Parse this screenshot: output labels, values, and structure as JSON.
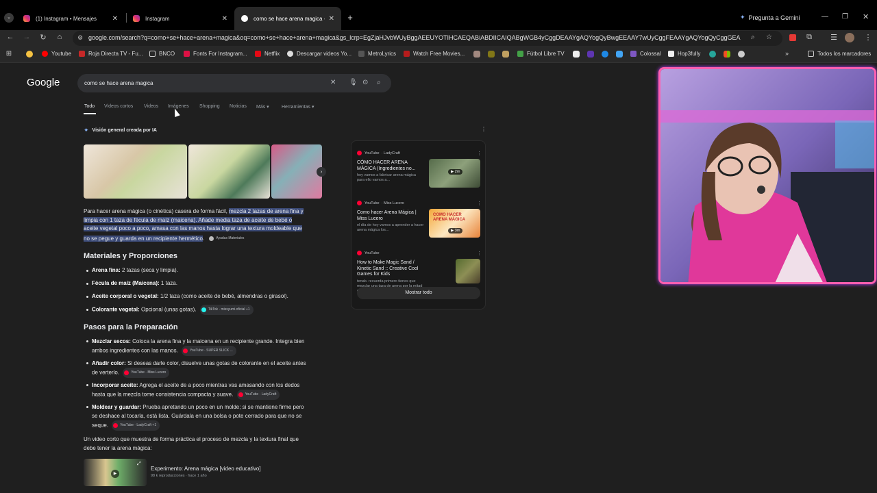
{
  "tabs": [
    {
      "title": "(1) Instagram • Mensajes",
      "active": false
    },
    {
      "title": "Instagram",
      "active": false
    },
    {
      "title": "como se hace arena magica - B",
      "active": true
    }
  ],
  "gemini_label": "Pregunta a Gemini",
  "url": "google.com/search?q=como+se+hace+arena+magica&oq=como+se+hace+arena+magica&gs_lcrp=EgZjaHJvbWUyBggAEEUYOTIHCAEQABiABDIICAIQABgWGB4yCggDEAAYgAQYogQyBwgEEAAY7wUyCggFEAAYgAQYogQyCggGEA",
  "bookmarks": [
    "Youtube",
    "Roja Directa TV - Fu...",
    "BNCO",
    "Fonts For Instagram...",
    "Netflix",
    "Descargar videos Yo...",
    "MetroLyrics",
    "Watch Free Movies...",
    "Fútbol Libre TV",
    "Colossal",
    "Hop3fully"
  ],
  "all_bookmarks": "Todos los marcadores",
  "google_logo": "Google",
  "search_query": "como se hace arena magica",
  "nav_tabs": [
    "Todo",
    "Videos cortos",
    "Videos",
    "Imágenes",
    "Shopping",
    "Noticias",
    "Más",
    "Herramientas"
  ],
  "ai_overview_label": "Visión general creada por IA",
  "intro": {
    "plain": "Para hacer arena mágica (o cinética) casera de forma fácil, ",
    "line1_hl": "mezcla 2 tazas de arena fina y",
    "line2_hl": "limpia con 1 taza de fécula de maíz (maicena). Añade media taza de aceite de bebé o",
    "line3_hl": "aceite vegetal poco a poco, amasa con las manos hasta lograr una textura moldeable que",
    "line4_hl": "no se pegue y guarda en un recipiente hermético",
    "end": ".",
    "chip": "Ayudas Materiales"
  },
  "materials_title": "Materiales y Proporciones",
  "materials": [
    {
      "label": "Arena fina:",
      "text": " 2 tazas (seca y limpia)."
    },
    {
      "label": "Fécula de maíz (Maicena):",
      "text": " 1 taza."
    },
    {
      "label": "Aceite corporal o vegetal:",
      "text": " 1/2 taza (como aceite de bebé, almendras o girasol)."
    },
    {
      "label": "Colorante vegetal:",
      "text": " Opcional (unas gotas).",
      "chip": "TikTok · missyumi.oficial +1"
    }
  ],
  "steps_title": "Pasos para la Preparación",
  "steps": [
    {
      "label": "Mezclar secos:",
      "line1": " Coloca la arena fina y la maicena en un recipiente grande. Integra bien",
      "line2": "ambos ingredientes con las manos.",
      "chip": "YouTube · SUPER SLICK ..."
    },
    {
      "label": "Añadir color:",
      "line1": " Si deseas darle color, disuelve unas gotas de colorante en el aceite antes",
      "line2": "de verterlo.",
      "chip": "YouTube · Miss Lucero"
    },
    {
      "label": "Incorporar aceite:",
      "line1": " Agrega el aceite de a poco mientras vas amasando con los dedos",
      "line2": "hasta que la mezcla tome consistencia compacta y suave.",
      "chip": "YouTube · LadyCraft"
    },
    {
      "label": "Moldear y guardar:",
      "line1": " Prueba apretando un poco en un molde; si se mantiene firme pero",
      "line2": "se deshace al tocarla, está lista. Guárdala en una bolsa o pote cerrado para que no se",
      "line3": "seque.",
      "chip": "YouTube · LadyCraft +1"
    }
  ],
  "short_video_intro1": "Un video corto que muestra de forma práctica el proceso de mezcla y la textura final que",
  "short_video_intro2": "debe tener la arena mágica:",
  "short_video": {
    "title": "Experimento: Arena mágica [video educativo]",
    "meta": "98 k reproducciones · hace 1 año"
  },
  "videos": [
    {
      "source": "YouTube",
      "channel": "· LadyCraft",
      "title": "CÓMO HACER ARENA MÁGICA (Ingredientes no...",
      "desc": "hoy vamos a fabricar arena mágica para ello vamos a...",
      "duration": "2m"
    },
    {
      "source": "YouTube",
      "channel": "· Miss Lucero",
      "title": "Como hacer Arena Mágica | Miss Lucero",
      "desc": "el día de hoy vamos a aprender a hacer arena mágica los...",
      "duration": "3m",
      "thumb_text": "COMO HACER ARENA MÁGICA"
    },
    {
      "source": "YouTube",
      "channel": "",
      "title": "How to Make Magic Sand / Kinetic Sand :: Creative Cool Games for Kids",
      "desc": "tenab. recuerda primero tienes que mezclar una taza de arena por la mitad de fécula de...",
      "duration": ""
    }
  ],
  "show_all": "Mostrar todo",
  "colors": {
    "accent_pink": "#ff5fb0",
    "highlight": "#3b4a77",
    "youtube_red": "#ff0033"
  }
}
